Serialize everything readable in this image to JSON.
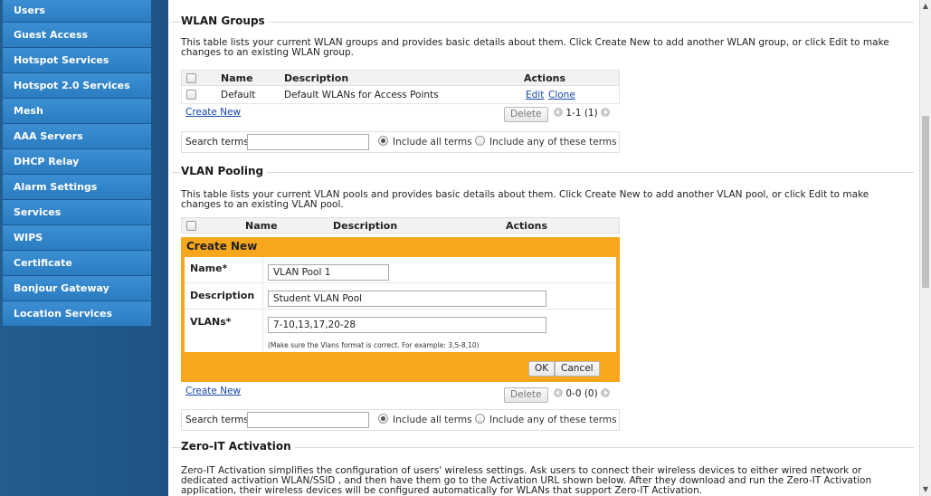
{
  "sidebar": {
    "items": [
      {
        "label": "Users"
      },
      {
        "label": "Guest Access"
      },
      {
        "label": "Hotspot Services"
      },
      {
        "label": "Hotspot 2.0 Services"
      },
      {
        "label": "Mesh"
      },
      {
        "label": "AAA Servers"
      },
      {
        "label": "DHCP Relay"
      },
      {
        "label": "Alarm Settings"
      },
      {
        "label": "Services"
      },
      {
        "label": "WIPS"
      },
      {
        "label": "Certificate"
      },
      {
        "label": "Bonjour Gateway"
      },
      {
        "label": "Location Services"
      }
    ]
  },
  "wlan_groups": {
    "title": "WLAN Groups",
    "description": "This table lists your current WLAN groups and provides basic details about them. Click Create New to add another WLAN group, or click Edit to make changes to an existing WLAN group.",
    "columns": {
      "name": "Name",
      "description": "Description",
      "actions": "Actions"
    },
    "rows": [
      {
        "name": "Default",
        "description": "Default WLANs for Access Points",
        "edit": "Edit",
        "clone": "Clone"
      }
    ],
    "create_new": "Create New",
    "delete": "Delete",
    "pager": "1-1 (1)",
    "search_label": "Search terms",
    "search_value": "",
    "radio_all": "Include all terms",
    "radio_any": "Include any of these terms"
  },
  "vlan_pooling": {
    "title": "VLAN Pooling",
    "description": "This table lists your current VLAN pools and provides basic details about them. Click Create New to add another VLAN pool, or click Edit to make changes to an existing VLAN pool.",
    "columns": {
      "name": "Name",
      "description": "Description",
      "actions": "Actions"
    },
    "form": {
      "title": "Create New",
      "name_label": "Name*",
      "name_value": "VLAN Pool 1",
      "description_label": "Description",
      "description_value": "Student VLAN Pool",
      "vlans_label": "VLANs*",
      "vlans_value": "7-10,13,17,20-28",
      "vlans_hint": "(Make sure the Vlans format is correct. For example: 3,5-8,10)",
      "ok": "OK",
      "cancel": "Cancel"
    },
    "create_new": "Create New",
    "delete": "Delete",
    "pager": "0-0 (0)",
    "search_label": "Search terms",
    "search_value": "",
    "radio_all": "Include all terms",
    "radio_any": "Include any of these terms"
  },
  "zero_it": {
    "title": "Zero-IT Activation",
    "description": "Zero-IT Activation simplifies the configuration of users' wireless settings. Ask users to connect their wireless devices to either wired network or dedicated activation WLAN/SSID , and then have them go to the Activation URL shown below. After they download and run the Zero-IT Activation application, their wireless devices will be configured automatically for WLANs that support Zero-IT Activation."
  }
}
